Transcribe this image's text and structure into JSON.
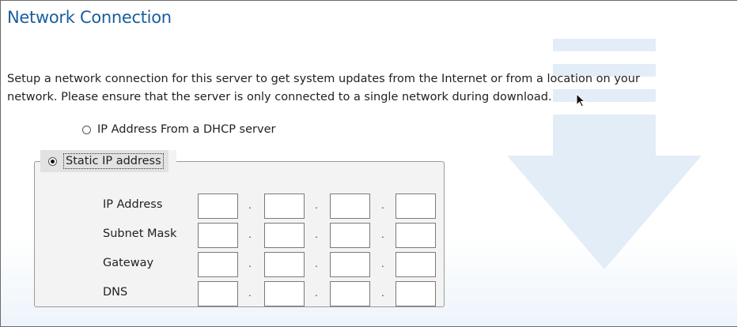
{
  "header": {
    "title": "Network Connection"
  },
  "description": {
    "line1": "Setup a network connection for this server to get system updates from the Internet or from a location on your",
    "line2": "network. Please ensure that the server is only connected to a single network during download."
  },
  "options": {
    "dhcp_label": "IP Address From a DHCP server",
    "dhcp_selected": false,
    "static_label": "Static IP address",
    "static_selected": true
  },
  "static_fields": [
    {
      "label": "IP Address",
      "octets": [
        "",
        "",
        "",
        ""
      ]
    },
    {
      "label": "Subnet Mask",
      "octets": [
        "",
        "",
        "",
        ""
      ]
    },
    {
      "label": "Gateway",
      "octets": [
        "",
        "",
        "",
        ""
      ]
    },
    {
      "label": "DNS",
      "octets": [
        "",
        "",
        "",
        ""
      ]
    }
  ],
  "separator": ".",
  "colors": {
    "title": "#1a5e9c",
    "watermark": "#dce8f5",
    "group_bg": "#f3f3f3"
  }
}
